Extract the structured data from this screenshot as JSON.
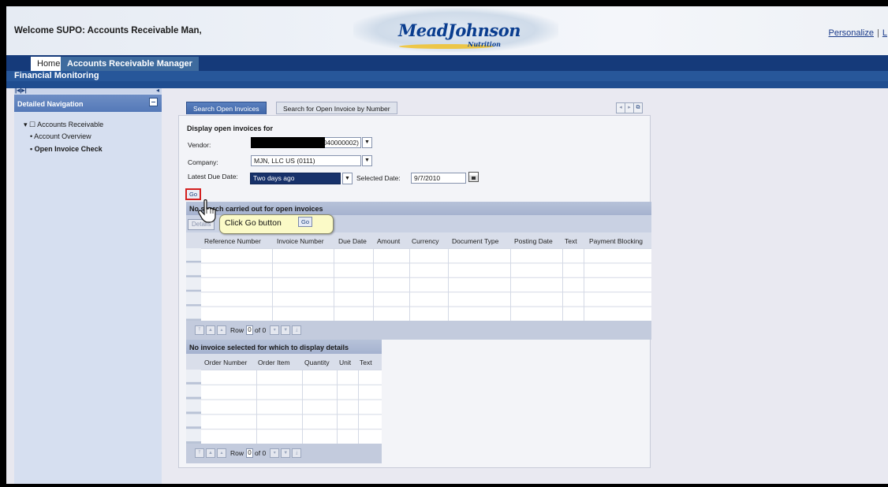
{
  "header": {
    "welcome": "Welcome SUPO: Accounts Receivable Man,",
    "logo_main": "MeadJohnson",
    "logo_sub": "Nutrition",
    "personalize": "Personalize",
    "separator": "|",
    "more": "L"
  },
  "nav": {
    "tabs": [
      {
        "label": "Home"
      },
      {
        "label": "Accounts Receivable Manager"
      }
    ],
    "sub": "Financial Monitoring"
  },
  "left_nav": {
    "title": "Detailed Navigation",
    "tree": [
      {
        "label": "Accounts Receivable"
      },
      {
        "label": "Account Overview"
      },
      {
        "label": "Open Invoice Check"
      }
    ]
  },
  "tabs": [
    {
      "label": "Search Open Invoices"
    },
    {
      "label": "Search for Open Invoice by Number"
    }
  ],
  "form": {
    "heading": "Display open invoices for",
    "vendor_label": "Vendor:",
    "vendor_value": "040000002)",
    "company_label": "Company:",
    "company_value": "MJN, LLC US (0111)",
    "due_label": "Latest Due Date:",
    "due_value": "Two days ago",
    "selected_label": "Selected Date:",
    "selected_value": "9/7/2010",
    "go_label": "Go"
  },
  "invoice_table": {
    "title": "No search carried out for open invoices",
    "details_button": "Details",
    "columns": [
      "Reference Number",
      "Invoice Number",
      "Due Date",
      "Amount",
      "Currency",
      "Document Type",
      "Posting Date",
      "Text",
      "Payment Blocking"
    ],
    "pager": {
      "label": "Row",
      "current": "0",
      "of": "of 0"
    }
  },
  "details_table": {
    "title": "No invoice selected for which to display details",
    "columns": [
      "Order Number",
      "Order Item",
      "Quantity",
      "Unit",
      "Text"
    ],
    "pager": {
      "label": "Row",
      "current": "0",
      "of": "of 0"
    }
  },
  "callout": {
    "text": "Click Go button",
    "go": "Go"
  },
  "colors": {
    "nav_dark": "#153a7a",
    "nav_tab_active": "#3e6b9e",
    "go_highlight": "#d42020",
    "callout_bg": "#fbfac7"
  },
  "icons": [
    "arrow-left-right-icon",
    "collapse-icon",
    "minimize-icon",
    "folder-icon",
    "dropdown-arrow-icon",
    "calendar-icon",
    "pointer-hand-icon"
  ]
}
